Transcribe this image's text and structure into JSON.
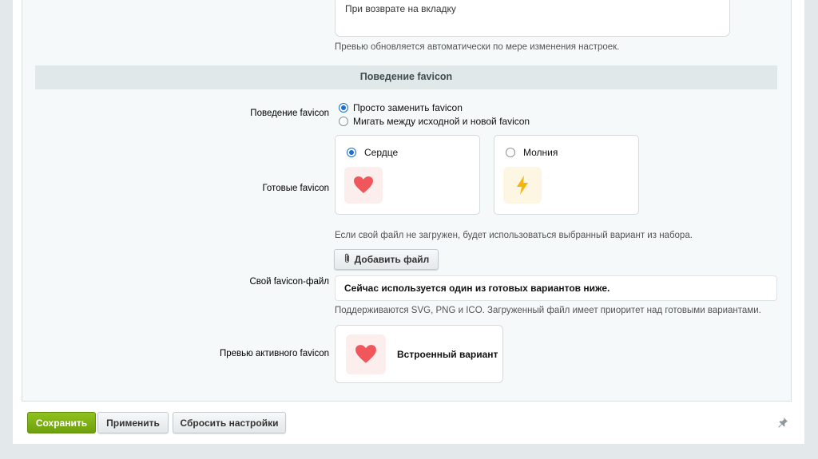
{
  "preview": {
    "value": "При возврате на вкладку",
    "note": "Превью обновляется автоматически по мере изменения настроек."
  },
  "section": {
    "title": "Поведение favicon"
  },
  "behavior": {
    "label": "Поведение favicon",
    "options": [
      {
        "label": "Просто заменить favicon",
        "selected": true
      },
      {
        "label": "Мигать между исходной и новой favicon",
        "selected": false
      }
    ]
  },
  "ready_favicons": {
    "label": "Готовые favicon",
    "options": [
      {
        "label": "Сердце",
        "icon": "heart-icon",
        "selected": true
      },
      {
        "label": "Молния",
        "icon": "lightning-icon",
        "selected": false
      }
    ],
    "note": "Если свой файл не загружен, будет использоваться выбранный вариант из набора."
  },
  "custom_file": {
    "label": "Свой favicon-файл",
    "button_label": "Добавить файл",
    "current": "Сейчас используется один из готовых вариантов ниже.",
    "note": "Поддерживаются SVG, PNG и ICO. Загруженный файл имеет приоритет над готовыми вариантами."
  },
  "active_preview": {
    "label": "Превью активного favicon",
    "title": "Встроенный вариант",
    "icon": "heart-icon"
  },
  "footer": {
    "save": "Сохранить",
    "apply": "Применить",
    "reset": "Сбросить настройки"
  },
  "colors": {
    "heart": "#f0565a",
    "bolt": "#f5b50a",
    "save_button": "#7cb014",
    "radio_selected": "#1a6fd1"
  }
}
